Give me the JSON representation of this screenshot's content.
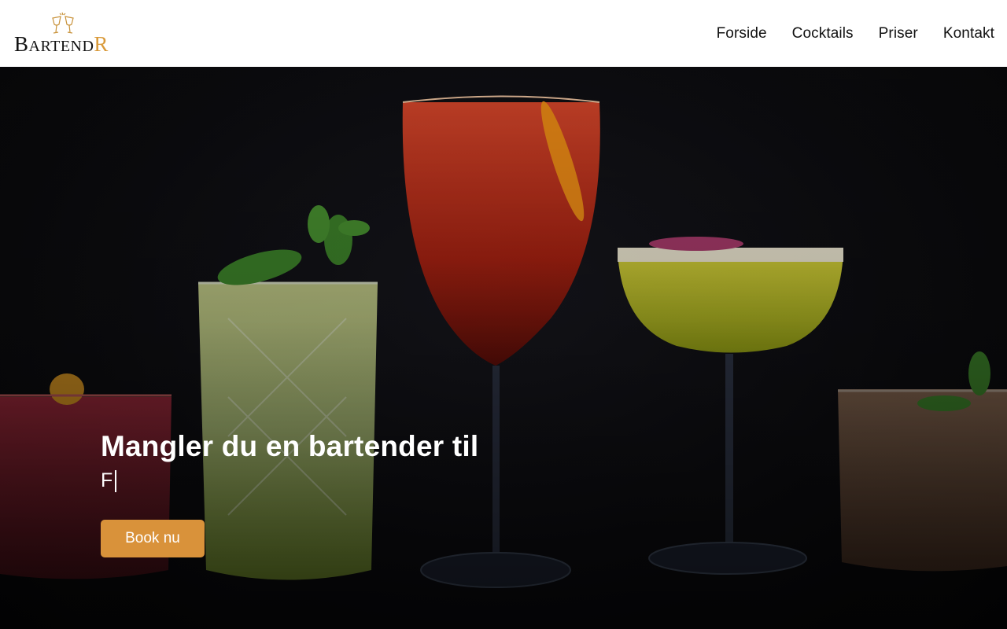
{
  "brand": {
    "logo_main": "B",
    "logo_mid": "ARTEND",
    "logo_end": "R",
    "accent_color": "#d99a3a"
  },
  "nav": {
    "items": [
      {
        "label": "Forside"
      },
      {
        "label": "Cocktails"
      },
      {
        "label": "Priser"
      },
      {
        "label": "Kontakt"
      }
    ]
  },
  "hero": {
    "title": "Mangler du en bartender til",
    "typed_text": "F",
    "button_label": "Book nu",
    "button_color": "#d9923a",
    "image_subject": "five cocktails on dark background"
  }
}
